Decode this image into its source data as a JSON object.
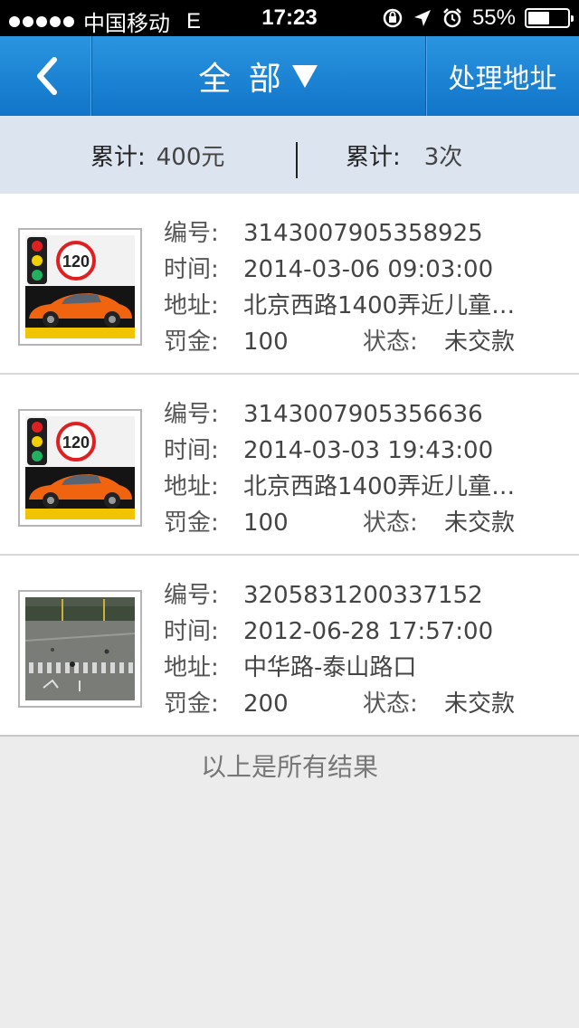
{
  "status_bar": {
    "carrier": "中国移动",
    "network": "E",
    "time": "17:23",
    "battery": "55%",
    "battery_level": 0.55
  },
  "nav": {
    "title": "全 部",
    "action_label": "处理地址"
  },
  "summary": {
    "amount_label": "累计:",
    "amount_value": "400元",
    "count_label": "累计:",
    "count_value": "3次"
  },
  "violations": [
    {
      "thumbnail": "speed-limit-120-car",
      "number_label": "编号:",
      "number": "3143007905358925",
      "time_label": "时间:",
      "time": "2014-03-06 09:03:00",
      "address_label": "地址:",
      "address": "北京西路1400弄近儿童…",
      "fine_label": "罚金:",
      "fine": "100",
      "status_label": "状态:",
      "status": "未交款"
    },
    {
      "thumbnail": "speed-limit-120-car",
      "number_label": "编号:",
      "number": "3143007905356636",
      "time_label": "时间:",
      "time": "2014-03-03 19:43:00",
      "address_label": "地址:",
      "address": "北京西路1400弄近儿童…",
      "fine_label": "罚金:",
      "fine": "100",
      "status_label": "状态:",
      "status": "未交款"
    },
    {
      "thumbnail": "intersection-photo",
      "number_label": "编号:",
      "number": "3205831200337152",
      "time_label": "时间:",
      "time": "2012-06-28 17:57:00",
      "address_label": "地址:",
      "address": "中华路-泰山路口",
      "fine_label": "罚金:",
      "fine": "200",
      "status_label": "状态:",
      "status": "未交款"
    }
  ],
  "footer_note": "以上是所有结果",
  "colors": {
    "nav_blue": "#1a82d4",
    "summary_bg": "#dce4ef",
    "page_bg": "#ececec"
  }
}
